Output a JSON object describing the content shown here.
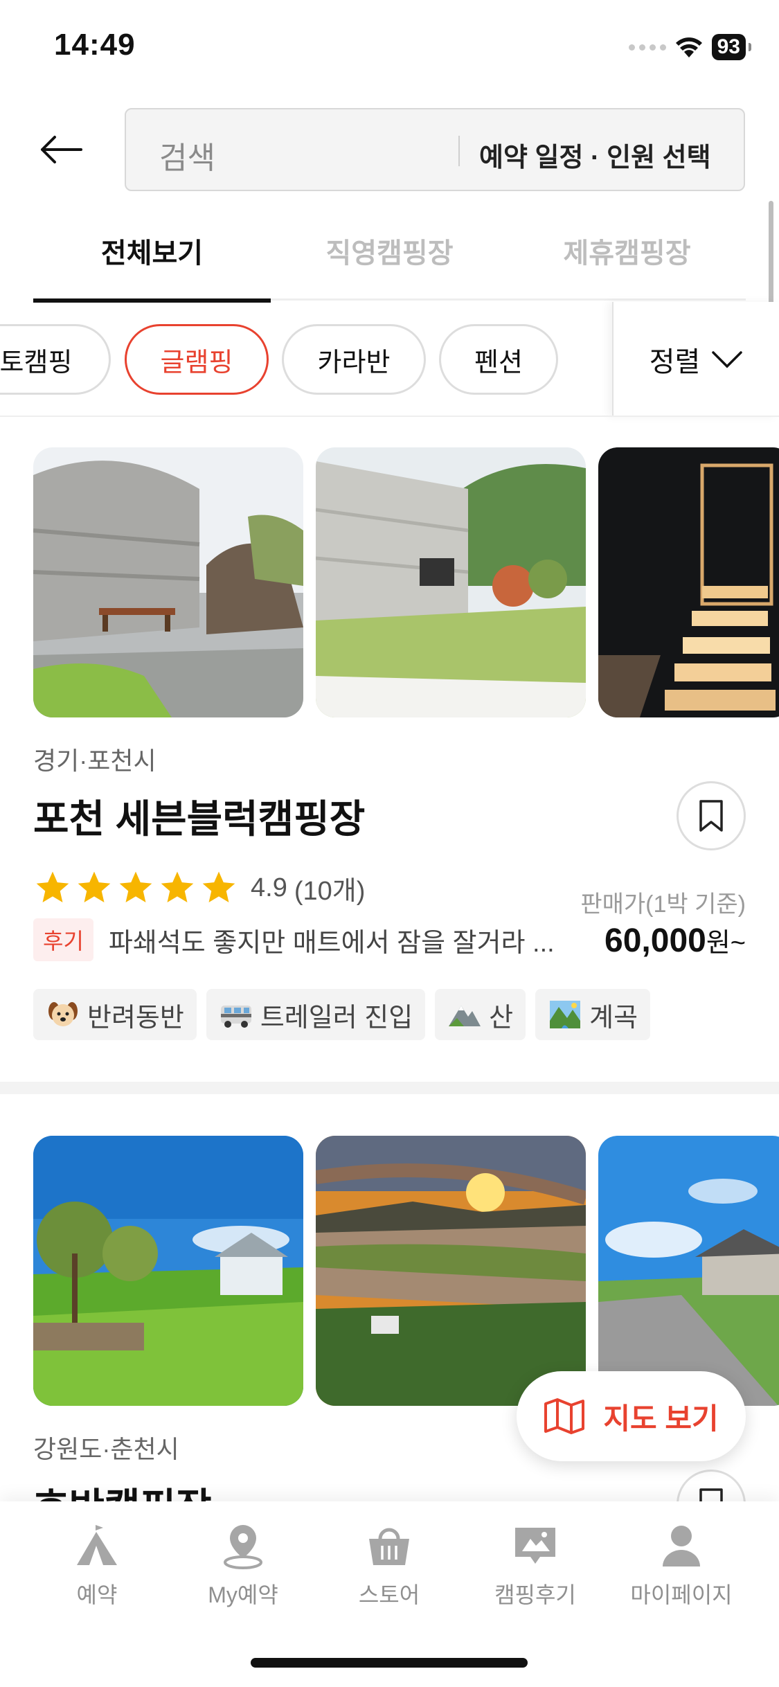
{
  "status_bar": {
    "time": "14:49",
    "battery": "93"
  },
  "header": {
    "search_placeholder": "검색",
    "date_people": "예약 일정 · 인원 선택"
  },
  "tabs": [
    {
      "label": "전체보기",
      "active": true
    },
    {
      "label": "직영캠핑장",
      "active": false
    },
    {
      "label": "제휴캠핑장",
      "active": false
    }
  ],
  "filters": {
    "chips": [
      {
        "label": "오토캠핑",
        "visible_text": "토캠핑",
        "active": false
      },
      {
        "label": "글램핑",
        "active": true
      },
      {
        "label": "카라반",
        "active": false
      },
      {
        "label": "펜션",
        "active": false
      }
    ],
    "sort_label": "정렬"
  },
  "listings": [
    {
      "region": "경기·포천시",
      "name": "포천 세븐블럭캠핑장",
      "rating": "4.9",
      "review_count": "(10개)",
      "stars": 5,
      "review_badge": "후기",
      "review_snippet": "파쇄석도 좋지만 매트에서 잠을 잘거라 ...",
      "price_label": "판매가(1박 기준)",
      "price": "60,000",
      "price_unit": "원~",
      "tags": [
        {
          "icon": "dog-icon",
          "label": "반려동반"
        },
        {
          "icon": "trailer-icon",
          "label": "트레일러 진입"
        },
        {
          "icon": "mountain-icon",
          "label": "산"
        },
        {
          "icon": "valley-icon",
          "label": "계곡"
        }
      ]
    },
    {
      "region": "강원도·춘천시",
      "name": "호반캠핑장"
    }
  ],
  "map_button": {
    "label": "지도 보기"
  },
  "bottom_nav": [
    {
      "icon": "tent-icon",
      "label": "예약"
    },
    {
      "icon": "location-pin-icon",
      "label": "My예약"
    },
    {
      "icon": "basket-icon",
      "label": "스토어"
    },
    {
      "icon": "review-image-icon",
      "label": "캠핑후기"
    },
    {
      "icon": "person-icon",
      "label": "마이페이지"
    }
  ],
  "colors": {
    "accent": "#e8422f",
    "star": "#f7b500",
    "text": "#111111",
    "muted": "#8f8f8f"
  }
}
